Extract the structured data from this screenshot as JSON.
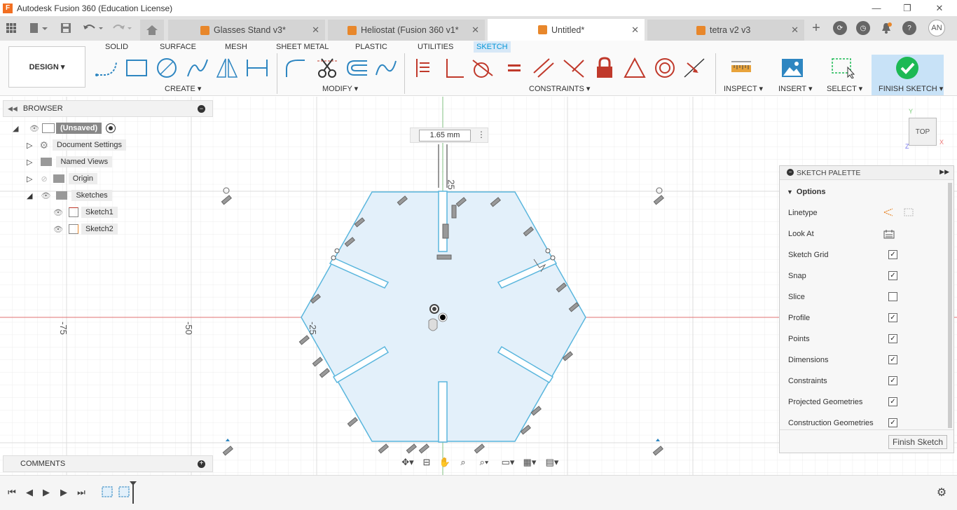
{
  "window": {
    "title": "Autodesk Fusion 360 (Education License)",
    "minimize": "—",
    "restore": "❐",
    "close": "✕"
  },
  "tabs": [
    {
      "label": "Glasses Stand v3*",
      "active": false
    },
    {
      "label": "Heliostat (Fusion 360 v1*",
      "active": false
    },
    {
      "label": "Untitled*",
      "active": true
    },
    {
      "label": "tetra v2 v3",
      "active": false
    }
  ],
  "user": {
    "initials": "AN"
  },
  "toolbar": {
    "workspace": "DESIGN ▾",
    "tabs": [
      "SOLID",
      "SURFACE",
      "MESH",
      "SHEET METAL",
      "PLASTIC",
      "UTILITIES",
      "SKETCH"
    ],
    "active_tab": "SKETCH",
    "groups": {
      "create": "CREATE ▾",
      "modify": "MODIFY ▾",
      "constraints": "CONSTRAINTS ▾",
      "inspect": "INSPECT ▾",
      "insert": "INSERT ▾",
      "select": "SELECT ▾",
      "finish": "FINISH SKETCH ▾"
    }
  },
  "browser": {
    "title": "BROWSER",
    "root": "(Unsaved)",
    "items": [
      "Document Settings",
      "Named Views",
      "Origin",
      "Sketches"
    ],
    "sketches": [
      "Sketch1",
      "Sketch2"
    ]
  },
  "comments": {
    "title": "COMMENTS"
  },
  "canvas": {
    "dimension_value": "1.65 mm",
    "axis_labels": [
      "-75",
      "-50",
      "-25",
      "25"
    ],
    "viewcube_label": "TOP",
    "axis_x": "X",
    "axis_y": "Y",
    "axis_z": "Z"
  },
  "palette": {
    "title": "SKETCH PALETTE",
    "section": "Options",
    "options": [
      {
        "label": "Linetype",
        "type": "icons"
      },
      {
        "label": "Look At",
        "type": "icon"
      },
      {
        "label": "Sketch Grid",
        "checked": true
      },
      {
        "label": "Snap",
        "checked": true
      },
      {
        "label": "Slice",
        "checked": false
      },
      {
        "label": "Profile",
        "checked": true
      },
      {
        "label": "Points",
        "checked": true
      },
      {
        "label": "Dimensions",
        "checked": true
      },
      {
        "label": "Constraints",
        "checked": true
      },
      {
        "label": "Projected Geometries",
        "checked": true
      },
      {
        "label": "Construction Geometries",
        "checked": true
      }
    ],
    "finish_button": "Finish Sketch"
  },
  "colors": {
    "accent": "#0696d7",
    "finish": "#1db954",
    "shape_fill": "#e3f0fa",
    "shape_stroke": "#5ab6dd",
    "axis_red": "#e07070",
    "axis_green": "#80c080"
  }
}
